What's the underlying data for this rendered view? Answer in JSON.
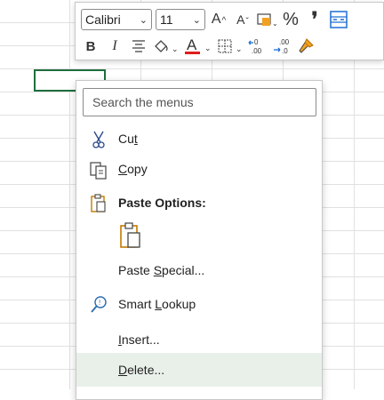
{
  "mini_toolbar": {
    "font_name": "Calibri",
    "font_size": "11",
    "buttons": [
      {
        "name": "increase-font-size",
        "icon": "A^"
      },
      {
        "name": "decrease-font-size",
        "icon": "Aˇ"
      },
      {
        "name": "accounting-format",
        "icon": "currency-icon"
      },
      {
        "name": "percent-style",
        "icon": "%"
      },
      {
        "name": "comma-style",
        "icon": ","
      },
      {
        "name": "merge-center",
        "icon": "merge-icon"
      },
      {
        "name": "bold",
        "icon": "B"
      },
      {
        "name": "italic",
        "icon": "I"
      },
      {
        "name": "center",
        "icon": "align-center-icon"
      },
      {
        "name": "fill-color",
        "icon": "paint-bucket-icon"
      },
      {
        "name": "font-color",
        "icon": "A"
      },
      {
        "name": "borders",
        "icon": "borders-icon"
      },
      {
        "name": "increase-decimal",
        "icon": "+.0"
      },
      {
        "name": "decrease-decimal",
        "icon": ".00"
      },
      {
        "name": "format-painter",
        "icon": "paintbrush-icon"
      }
    ],
    "accent_fill": "#f2a11f",
    "accent_font": "#e11c1c",
    "accent_blue": "#1d6fd4"
  },
  "menu": {
    "search_placeholder": "Search the menus",
    "items": [
      {
        "label": "Cut",
        "icon": "scissors-icon",
        "underline": "t"
      },
      {
        "label": "Copy",
        "icon": "copy-icon",
        "underline": "C"
      },
      {
        "label": "Paste Options:",
        "icon": "clipboard-icon"
      },
      {
        "label": "Paste Special...",
        "icon": ""
      },
      {
        "label": "Smart Lookup",
        "icon": "smart-lookup-icon"
      },
      {
        "label": "Insert...",
        "icon": ""
      },
      {
        "label": "Delete...",
        "icon": ""
      }
    ],
    "hover_color": "#e9f0ea"
  },
  "grid": {
    "selected_border": "#1e6f3d"
  }
}
